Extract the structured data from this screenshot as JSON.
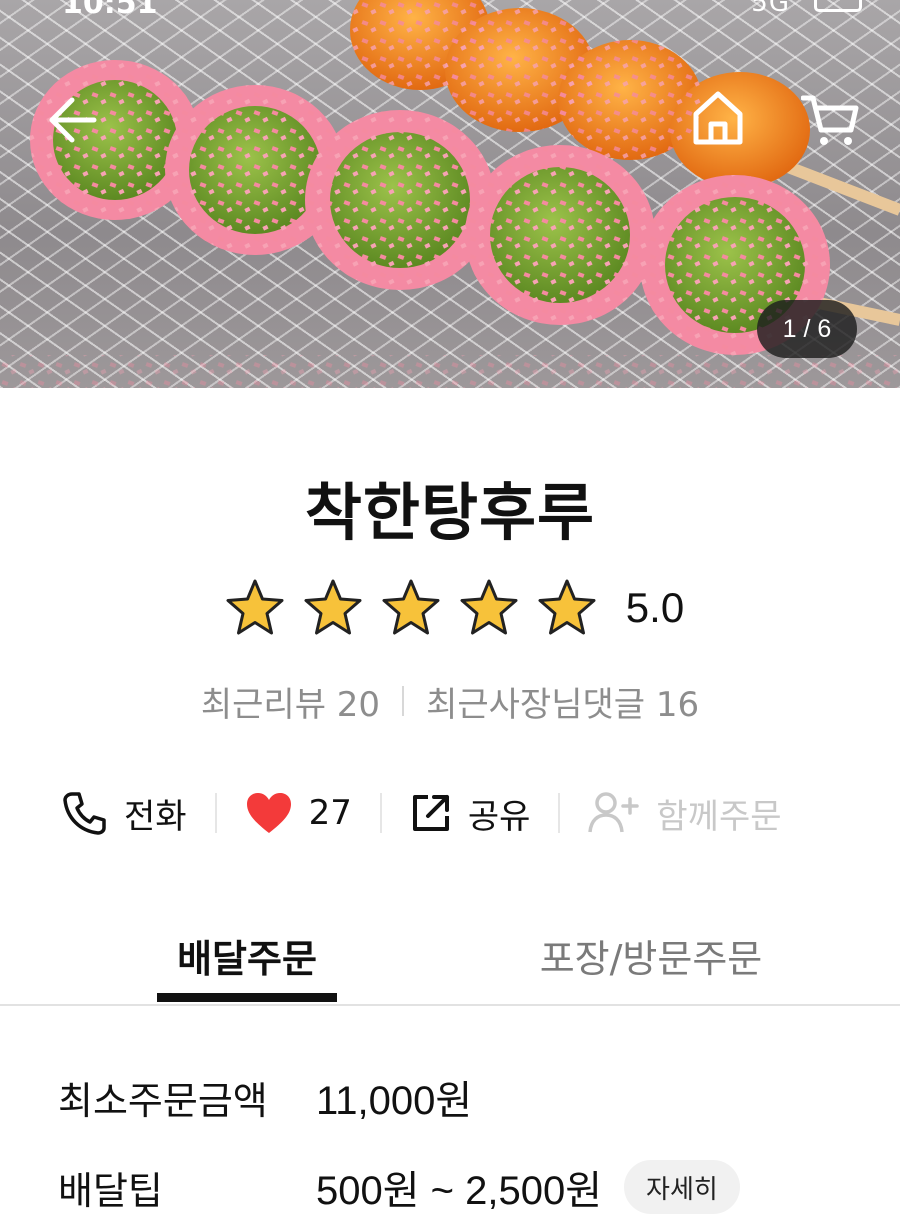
{
  "status_bar": {
    "time": "10:51",
    "signal": "5G"
  },
  "hero": {
    "image_counter": "1 / 6"
  },
  "store": {
    "name": "착한탕후루",
    "rating": "5.0",
    "stars": 5,
    "recent_reviews": "최근리뷰 20",
    "owner_replies": "최근사장님댓글 16"
  },
  "actions": {
    "call": "전화",
    "likes": "27",
    "share": "공유",
    "group_order": "함께주문"
  },
  "tabs": {
    "delivery": "배달주문",
    "pickup": "포장/방문주문"
  },
  "order_info": {
    "min_order_label": "최소주문금액",
    "min_order_value": "11,000원",
    "delivery_tip_label": "배달팁",
    "delivery_tip_value": "500원 ~ 2,500원",
    "detail_button": "자세히"
  },
  "colors": {
    "heart": "#f33a3a",
    "star": "#f7c23a",
    "tab_indicator": "#111111"
  },
  "icons": {
    "back": "arrow-left-icon",
    "home": "home-icon",
    "cart": "cart-icon",
    "call": "phone-icon",
    "like": "heart-icon",
    "share": "share-icon",
    "group_order": "person-add-icon",
    "rating": "star-icon"
  }
}
